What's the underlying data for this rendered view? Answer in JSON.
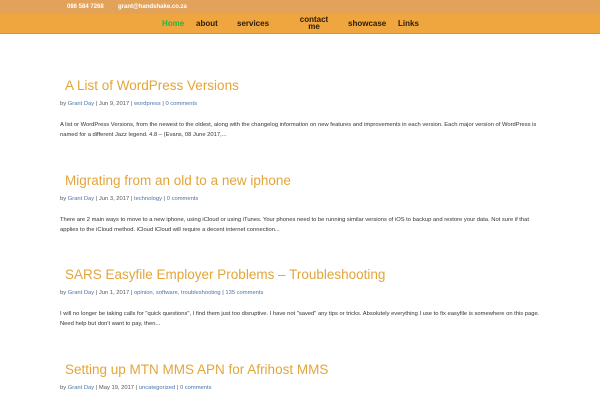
{
  "topbar": {
    "phone": "086 584 7268",
    "email": "grant@handshake.co.za"
  },
  "nav": {
    "items": [
      {
        "label": "Home"
      },
      {
        "label": "about"
      },
      {
        "label": "services"
      },
      {
        "label": "contact\nme"
      },
      {
        "label": "showcase"
      },
      {
        "label": "Links"
      }
    ]
  },
  "posts": [
    {
      "title": "A List of WordPress Versions",
      "by": "by",
      "author": "Grant Day",
      "date": "Jun 9, 2017",
      "categories": "wordpress",
      "comments": "0 comments",
      "excerpt": "A list or WordPress Versions, from the newest to the oldest, along with the changelog information on new features and improvements in each version. Each major version of WordPress is named for a different Jazz legend. 4.8 – (Evans, 08 June 2017,..."
    },
    {
      "title": "Migrating from an old to a new iphone",
      "by": "by",
      "author": "Grant Day",
      "date": "Jun 3, 2017",
      "categories": "technology",
      "comments": "0 comments",
      "excerpt": "There are 2 main ways to move to a new iphone, using iCloud or using iTunes. Your phones need to be running similar versions of iOS to backup and restore your data. Not sure if that applies to the iCloud method. iCloud iCloud will require a decent internet connection..."
    },
    {
      "title": "SARS Easyfile Employer Problems – Troubleshooting",
      "by": "by",
      "author": "Grant Day",
      "date": "Jun 1, 2017",
      "categories": "opinion, software, troubleshooting",
      "comments": "135 comments",
      "excerpt": "I will no longer be taking calls for \"quick questions\", I find them just too disruptive. I have not \"saved\" any tips or tricks. Absolutely everything I use to fix easyfile is somewhere on this page. Need help but don't want to pay, then..."
    },
    {
      "title": "Setting up MTN MMS APN for Afrihost MMS",
      "by": "by",
      "author": "Grant Day",
      "date": "May 19, 2017",
      "categories": "uncategorized",
      "comments": "0 comments",
      "excerpt": ""
    }
  ],
  "colors": {
    "topbar": "#e2a25a",
    "nav": "#f0a63e",
    "nav_active": "#2bb33d",
    "title": "#e3a53a",
    "link": "#4b74a8"
  }
}
